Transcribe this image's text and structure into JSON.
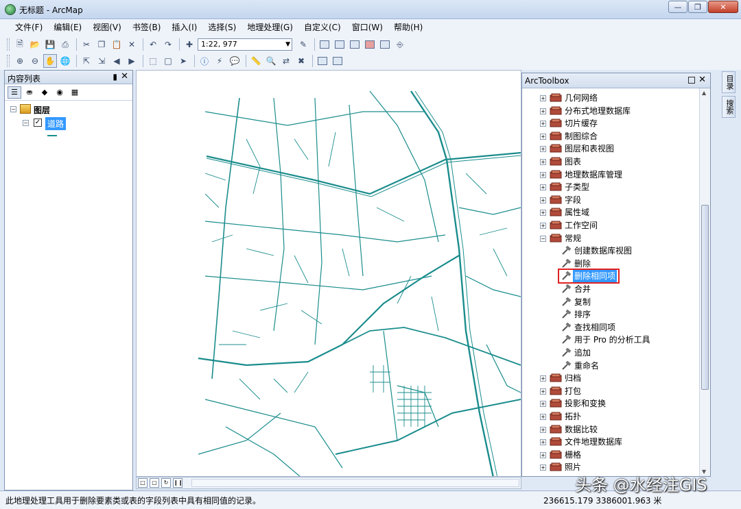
{
  "window": {
    "title": "无标题 - ArcMap"
  },
  "menu": [
    "文件(F)",
    "编辑(E)",
    "视图(V)",
    "书签(B)",
    "插入(I)",
    "选择(S)",
    "地理处理(G)",
    "自定义(C)",
    "窗口(W)",
    "帮助(H)"
  ],
  "toolbar": {
    "scale": "1:22, 977"
  },
  "toc": {
    "title": "内容列表",
    "root_label": "图层",
    "layer_label": "道路"
  },
  "toolbox": {
    "title": "ArcToolbox",
    "sets_top": [
      "几何网络",
      "分布式地理数据库",
      "切片缓存",
      "制图综合",
      "图层和表视图",
      "图表",
      "地理数据库管理",
      "子类型",
      "字段",
      "属性域",
      "工作空间"
    ],
    "expanded": "常规",
    "tools": [
      "创建数据库视图",
      "删除",
      "删除相同项",
      "合并",
      "复制",
      "排序",
      "查找相同项",
      "用于 Pro 的分析工具",
      "追加",
      "重命名"
    ],
    "selected_tool": "删除相同项",
    "sets_bottom": [
      "归档",
      "打包",
      "投影和变换",
      "拓扑",
      "数据比较",
      "文件地理数据库",
      "栅格",
      "照片"
    ]
  },
  "dock_tabs": [
    "目录",
    "搜索"
  ],
  "status": {
    "message": "此地理处理工具用于删除要素类或表的字段列表中具有相同值的记录。",
    "coordinates": "236615.179  3386001.963 米"
  },
  "watermark": "头条 @水经注GIS",
  "colors": {
    "road": "#1a8c8c",
    "selection": "#3399ff",
    "highlight": "#e02020"
  }
}
